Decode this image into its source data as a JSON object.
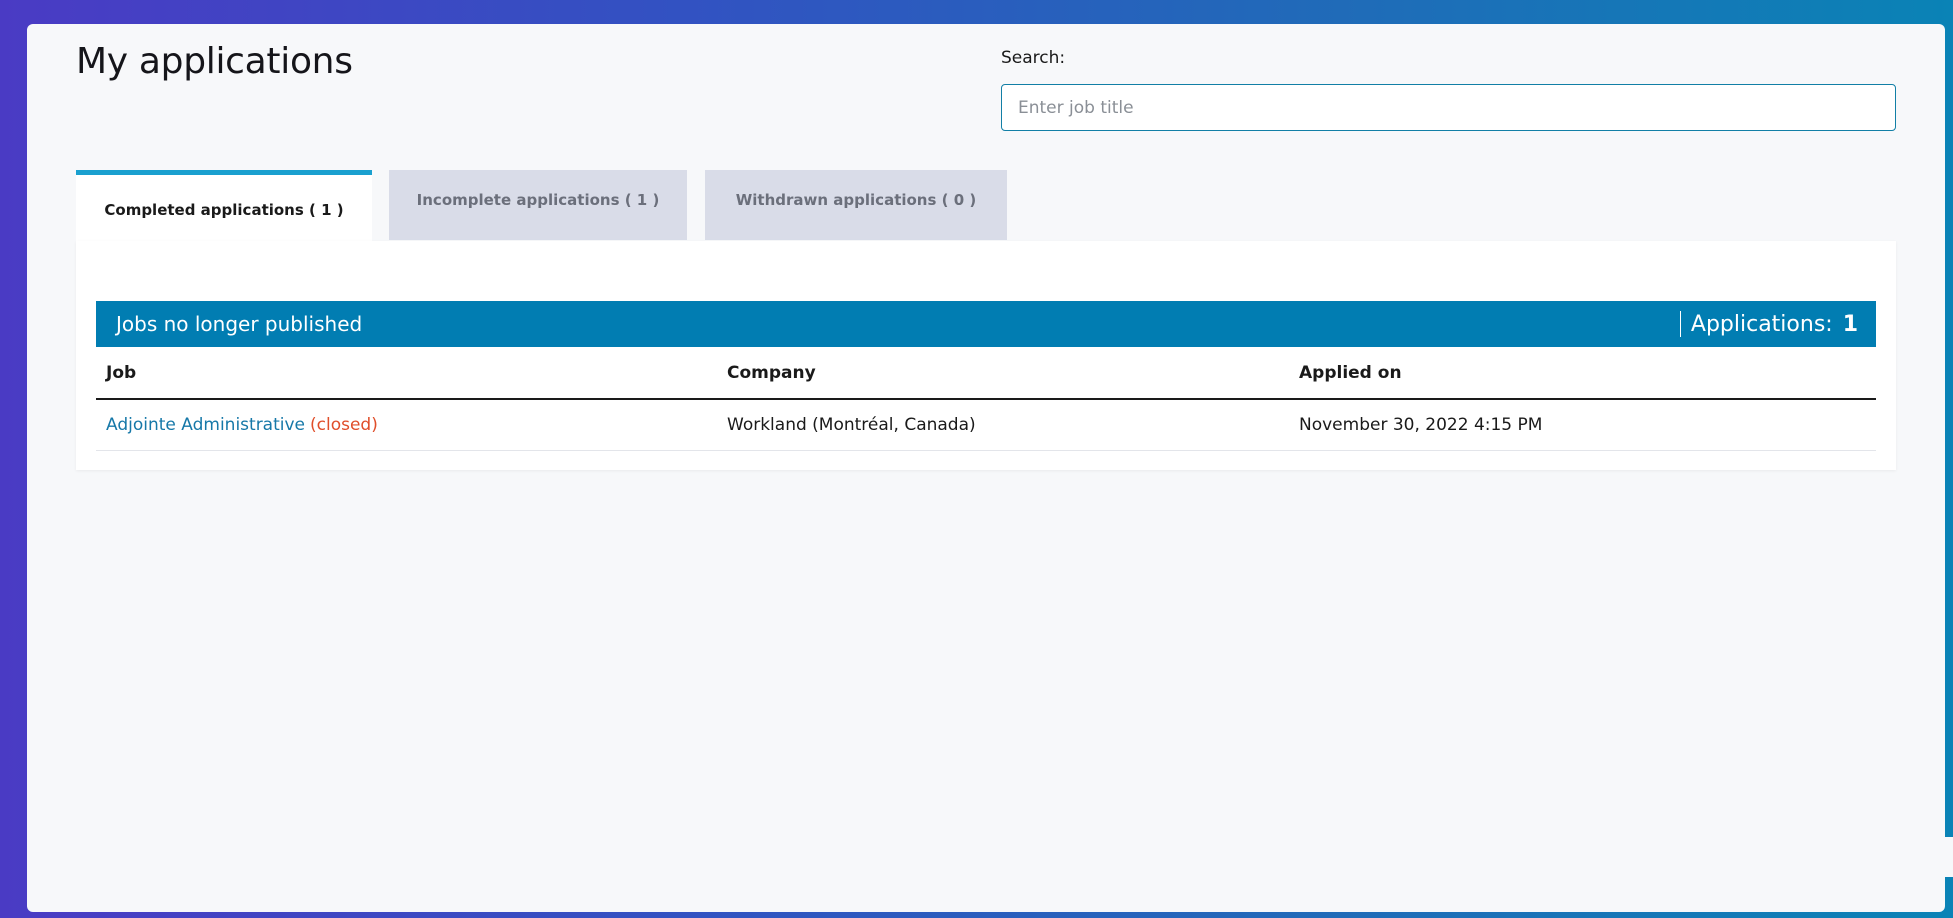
{
  "page": {
    "title": "My applications"
  },
  "search": {
    "label": "Search:",
    "placeholder": "Enter job title",
    "value": ""
  },
  "tabs": [
    {
      "label": "Completed applications ( 1 )",
      "active": true
    },
    {
      "label": "Incomplete applications ( 1 )",
      "active": false
    },
    {
      "label": "Withdrawn applications ( 0 )",
      "active": false
    }
  ],
  "section": {
    "title": "Jobs no longer published",
    "count_label": "Applications:",
    "count_value": "1"
  },
  "table": {
    "headers": {
      "job": "Job",
      "company": "Company",
      "applied_on": "Applied on"
    },
    "rows": [
      {
        "job": "Adjointe Administrative",
        "status": "(closed)",
        "company": "Workland (Montréal, Canada)",
        "applied_on": "November 30, 2022 4:15 PM"
      }
    ]
  },
  "colors": {
    "accent": "#017db2",
    "tab_indicator": "#1aa0cf",
    "link": "#1678a8",
    "status_closed": "#e04e2a",
    "inactive_tab": "#d9dce8"
  }
}
